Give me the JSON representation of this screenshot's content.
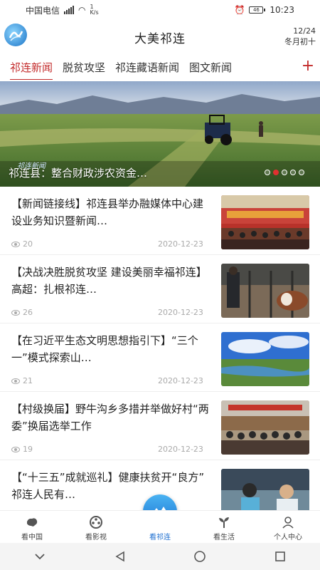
{
  "statusbar": {
    "carrier": "中国电信",
    "network": "4G",
    "speed": "1\nK/s",
    "battery": "46",
    "time": "10:23"
  },
  "header": {
    "title": "大美祁连",
    "date": "12/24",
    "lunar": "冬月初十"
  },
  "tabs": [
    {
      "label": "祁连新闻",
      "active": true
    },
    {
      "label": "脱贫攻坚",
      "active": false
    },
    {
      "label": "祁连藏语新闻",
      "active": false
    },
    {
      "label": "图文新闻",
      "active": false
    }
  ],
  "tabs_more": "+",
  "banner": {
    "caption": "祁连县：整合财政涉农资金…",
    "watermark": "祁连新闻",
    "dot_count": 5,
    "active_dot": 1
  },
  "news": [
    {
      "title": "【新闻链接线】祁连县举办融媒体中心建设业务知识暨新闻…",
      "views": "20",
      "date": "2020-12-23",
      "thumb": "conference-hall"
    },
    {
      "title": "【决战决胜脱贫攻坚  建设美丽幸福祁连】高超：扎根祁连…",
      "views": "26",
      "date": "2020-12-23",
      "thumb": "cattle-farm"
    },
    {
      "title": "【在习近平生态文明思想指引下】“三个一”模式探索山…",
      "views": "21",
      "date": "2020-12-23",
      "thumb": "grassland-lake"
    },
    {
      "title": "【村级换届】野牛沟乡多措并举做好村“两委”换届选举工作",
      "views": "19",
      "date": "2020-12-23",
      "thumb": "village-meeting"
    },
    {
      "title": "【“十三五”成就巡礼】健康扶贫开“良方”  祁连人民有…",
      "views": "",
      "date": "",
      "thumb": "medical-exam"
    }
  ],
  "bottom_nav": [
    {
      "label": "看中国",
      "icon": "china-map-icon",
      "active": false
    },
    {
      "label": "看影视",
      "icon": "film-reel-icon",
      "active": false
    },
    {
      "label": "看祁连",
      "icon": "mountain-icon",
      "active": true
    },
    {
      "label": "看生活",
      "icon": "sprout-icon",
      "active": false
    },
    {
      "label": "个人中心",
      "icon": "user-icon",
      "active": false
    }
  ],
  "colors": {
    "accent_red": "#c32b2b",
    "accent_blue": "#1e6fd0"
  }
}
